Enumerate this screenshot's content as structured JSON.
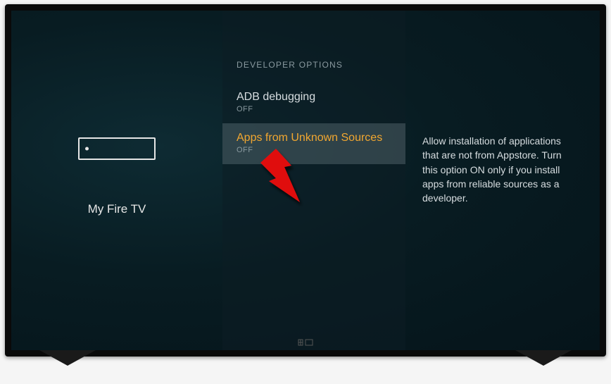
{
  "device": {
    "label": "My Fire TV",
    "icon_name": "firetv-stick-icon"
  },
  "section": {
    "header": "DEVELOPER OPTIONS",
    "items": [
      {
        "title": "ADB debugging",
        "status": "OFF",
        "selected": false
      },
      {
        "title": "Apps from Unknown Sources",
        "status": "OFF",
        "selected": true
      }
    ]
  },
  "help": {
    "text": "Allow installation of applications that are not from Appstore. Turn this option ON only if you install apps from reliable sources as a developer."
  },
  "colors": {
    "accent": "#f2a730"
  }
}
